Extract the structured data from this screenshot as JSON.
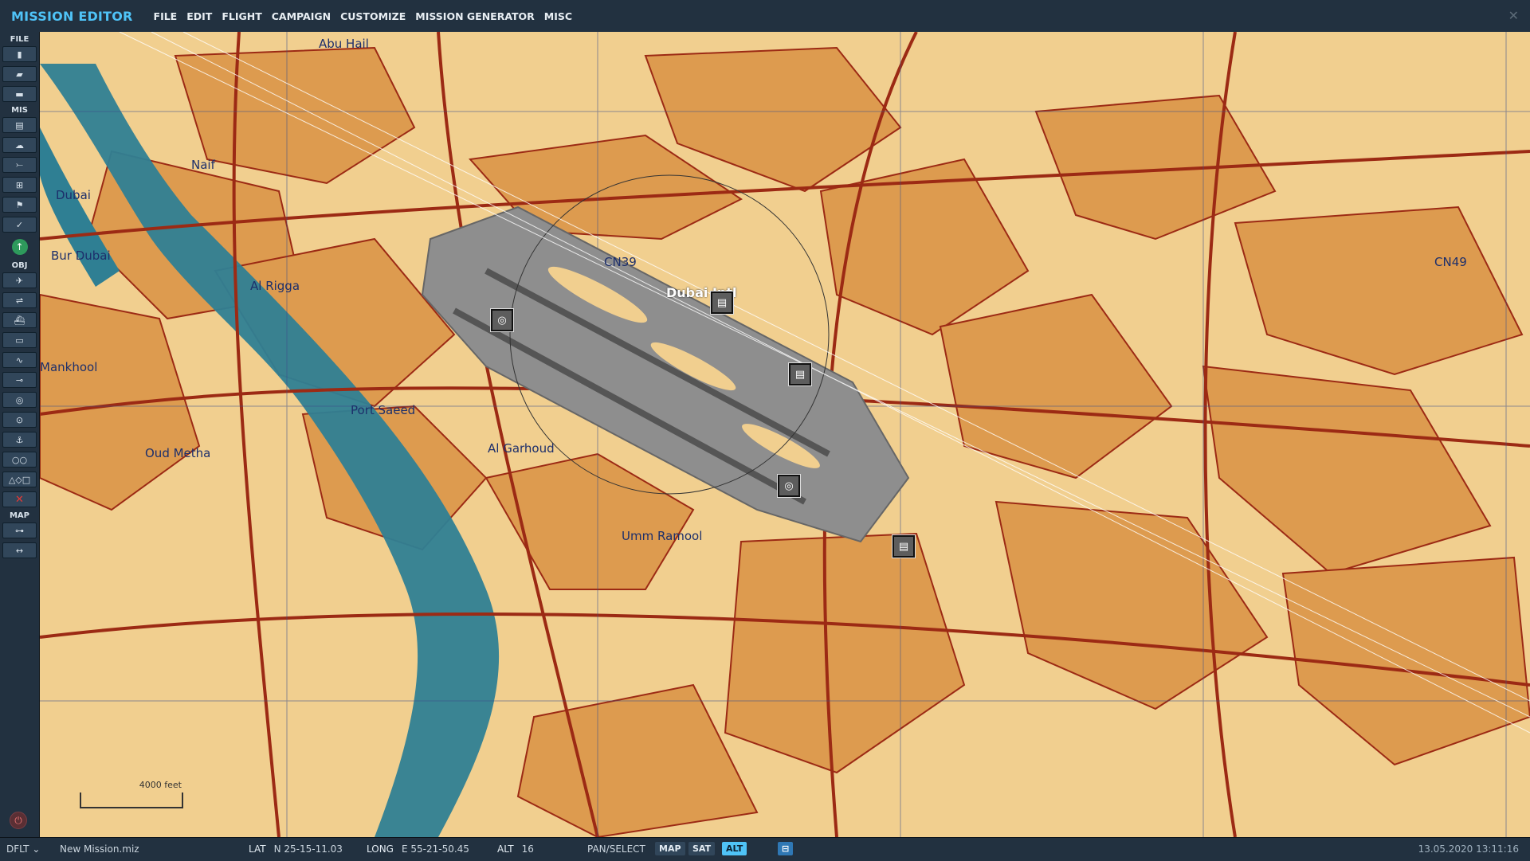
{
  "app": {
    "title": "MISSION EDITOR",
    "close_icon": "close-icon"
  },
  "menu": [
    "FILE",
    "EDIT",
    "FLIGHT",
    "CAMPAIGN",
    "CUSTOMIZE",
    "MISSION GENERATOR",
    "MISC"
  ],
  "sidebar": {
    "file_section": "FILE",
    "mis_section": "MIS",
    "obj_section": "OBJ",
    "map_section": "MAP",
    "file_icons": [
      "new-file-icon",
      "open-folder-icon",
      "save-icon"
    ],
    "mis_icons": [
      "briefing-icon",
      "weather-icon",
      "aircraft-group-icon",
      "trigger-icon",
      "goals-icon",
      "check-icon"
    ],
    "obj_icons": [
      "plane-icon",
      "helicopter-icon",
      "ship-icon",
      "vehicle-icon",
      "static-icon",
      "waypoint-icon",
      "zone-icon",
      "target-icon",
      "naval-icon",
      "formation-icon",
      "shapes-icon",
      "delete-icon"
    ],
    "map_icons": [
      "key-icon",
      "ruler-icon"
    ]
  },
  "map": {
    "labels": [
      {
        "name": "abu-hail",
        "text": "Abu Hail"
      },
      {
        "name": "naif",
        "text": "Naif"
      },
      {
        "name": "dubai",
        "text": "Dubai"
      },
      {
        "name": "bur-dubai",
        "text": "Bur Dubai"
      },
      {
        "name": "al-rigga",
        "text": "Al Rigga"
      },
      {
        "name": "mankhool",
        "text": "Mankhool"
      },
      {
        "name": "port-saeed",
        "text": "Port Saeed"
      },
      {
        "name": "oud-metha",
        "text": "Oud Metha"
      },
      {
        "name": "al-garhoud",
        "text": "Al Garhoud"
      },
      {
        "name": "umm-ramool",
        "text": "Umm Ramool"
      },
      {
        "name": "cn39",
        "text": "CN39"
      },
      {
        "name": "cn49",
        "text": "CN49"
      },
      {
        "name": "airport",
        "text": "Dubai Intl"
      }
    ],
    "scale_text": "4000 feet",
    "colors": {
      "land_light": "#f1cf8f",
      "land_dark": "#dd9b4f",
      "water": "#2f7f93",
      "road": "#9c2a14",
      "airfield": "#8e8e8e"
    }
  },
  "status": {
    "profile": "DFLT",
    "filename": "New Mission.miz",
    "lat_label": "LAT",
    "lat": "N 25-15-11.03",
    "long_label": "LONG",
    "long": "E 55-21-50.45",
    "alt_label": "ALT",
    "alt": "16",
    "pan_select": "PAN/SELECT",
    "map_btn": "MAP",
    "sat_btn": "SAT",
    "alt_btn": "ALT",
    "datetime": "13.05.2020 13:11:16"
  }
}
